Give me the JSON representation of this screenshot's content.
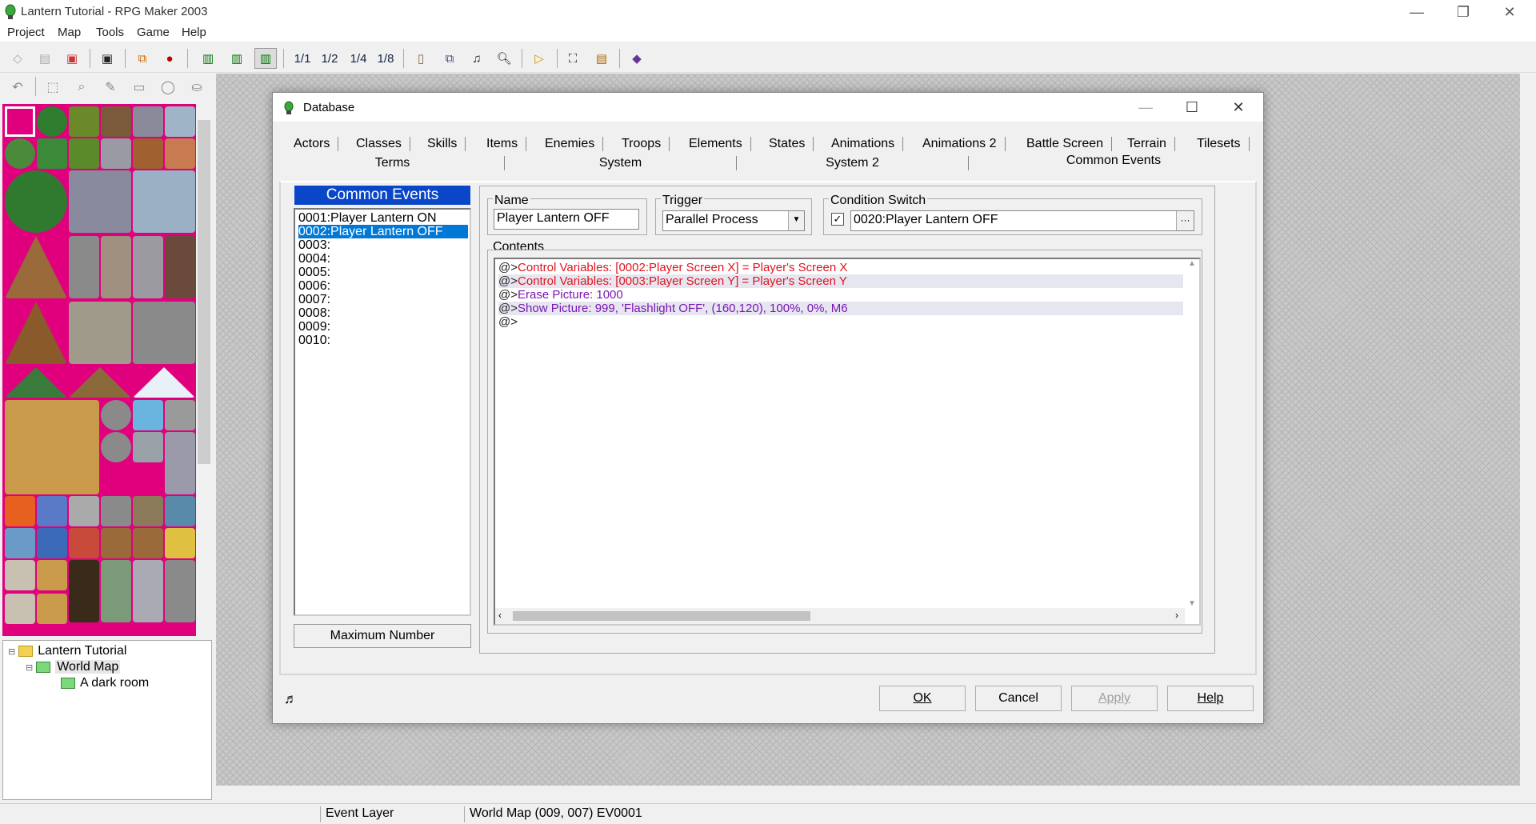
{
  "window": {
    "title": "Lantern Tutorial - RPG Maker 2003"
  },
  "menu": [
    "Project",
    "Map",
    "Tools",
    "Game",
    "Help"
  ],
  "toolbar": {
    "zoom_labels": [
      "1/1",
      "1/2",
      "1/4",
      "1/8"
    ]
  },
  "map_tree": {
    "items": [
      {
        "label": "Lantern Tutorial"
      },
      {
        "label": "World Map"
      },
      {
        "label": "A dark room"
      }
    ]
  },
  "status_bar": {
    "layer": "Event Layer",
    "location": "World Map (009, 007) EV0001"
  },
  "dialog": {
    "title": "Database",
    "tabs_row1": [
      "Actors",
      "Classes",
      "Skills",
      "Items",
      "Enemies",
      "Troops",
      "Elements",
      "States",
      "Animations",
      "Animations 2",
      "Battle Screen",
      "Terrain",
      "Tilesets"
    ],
    "tabs_row2": [
      "Terms",
      "System",
      "System 2",
      "Common Events"
    ],
    "active_tab": "Common Events",
    "list_header": "Common Events",
    "list_items": [
      "0001:Player Lantern ON",
      "0002:Player Lantern OFF",
      "0003:",
      "0004:",
      "0005:",
      "0006:",
      "0007:",
      "0008:",
      "0009:",
      "0010:"
    ],
    "selected_index": 1,
    "max_number_label": "Maximum Number",
    "name_label": "Name",
    "name_value": "Player Lantern OFF",
    "trigger_label": "Trigger",
    "trigger_value": "Parallel Process",
    "condition_label": "Condition Switch",
    "condition_value": "0020:Player Lantern OFF",
    "condition_checked": true,
    "contents_label": "Contents",
    "contents": [
      {
        "prefix": "@>",
        "text": "Control Variables: [0002:Player Screen X] = Player's Screen X",
        "color": "#e0141e"
      },
      {
        "prefix": "@>",
        "text": "Control Variables: [0003:Player Screen Y] = Player's Screen Y",
        "color": "#e0141e"
      },
      {
        "prefix": "@>",
        "text": "Erase Picture: 1000",
        "color": "#7b16b5"
      },
      {
        "prefix": "@>",
        "text": "Show Picture: 999, 'Flashlight OFF', (160,120), 100%, 0%, M6",
        "color": "#7b16b5"
      },
      {
        "prefix": "@>",
        "text": "",
        "color": "#222222"
      }
    ],
    "buttons": {
      "ok": "OK",
      "cancel": "Cancel",
      "apply": "Apply",
      "help": "Help"
    }
  }
}
